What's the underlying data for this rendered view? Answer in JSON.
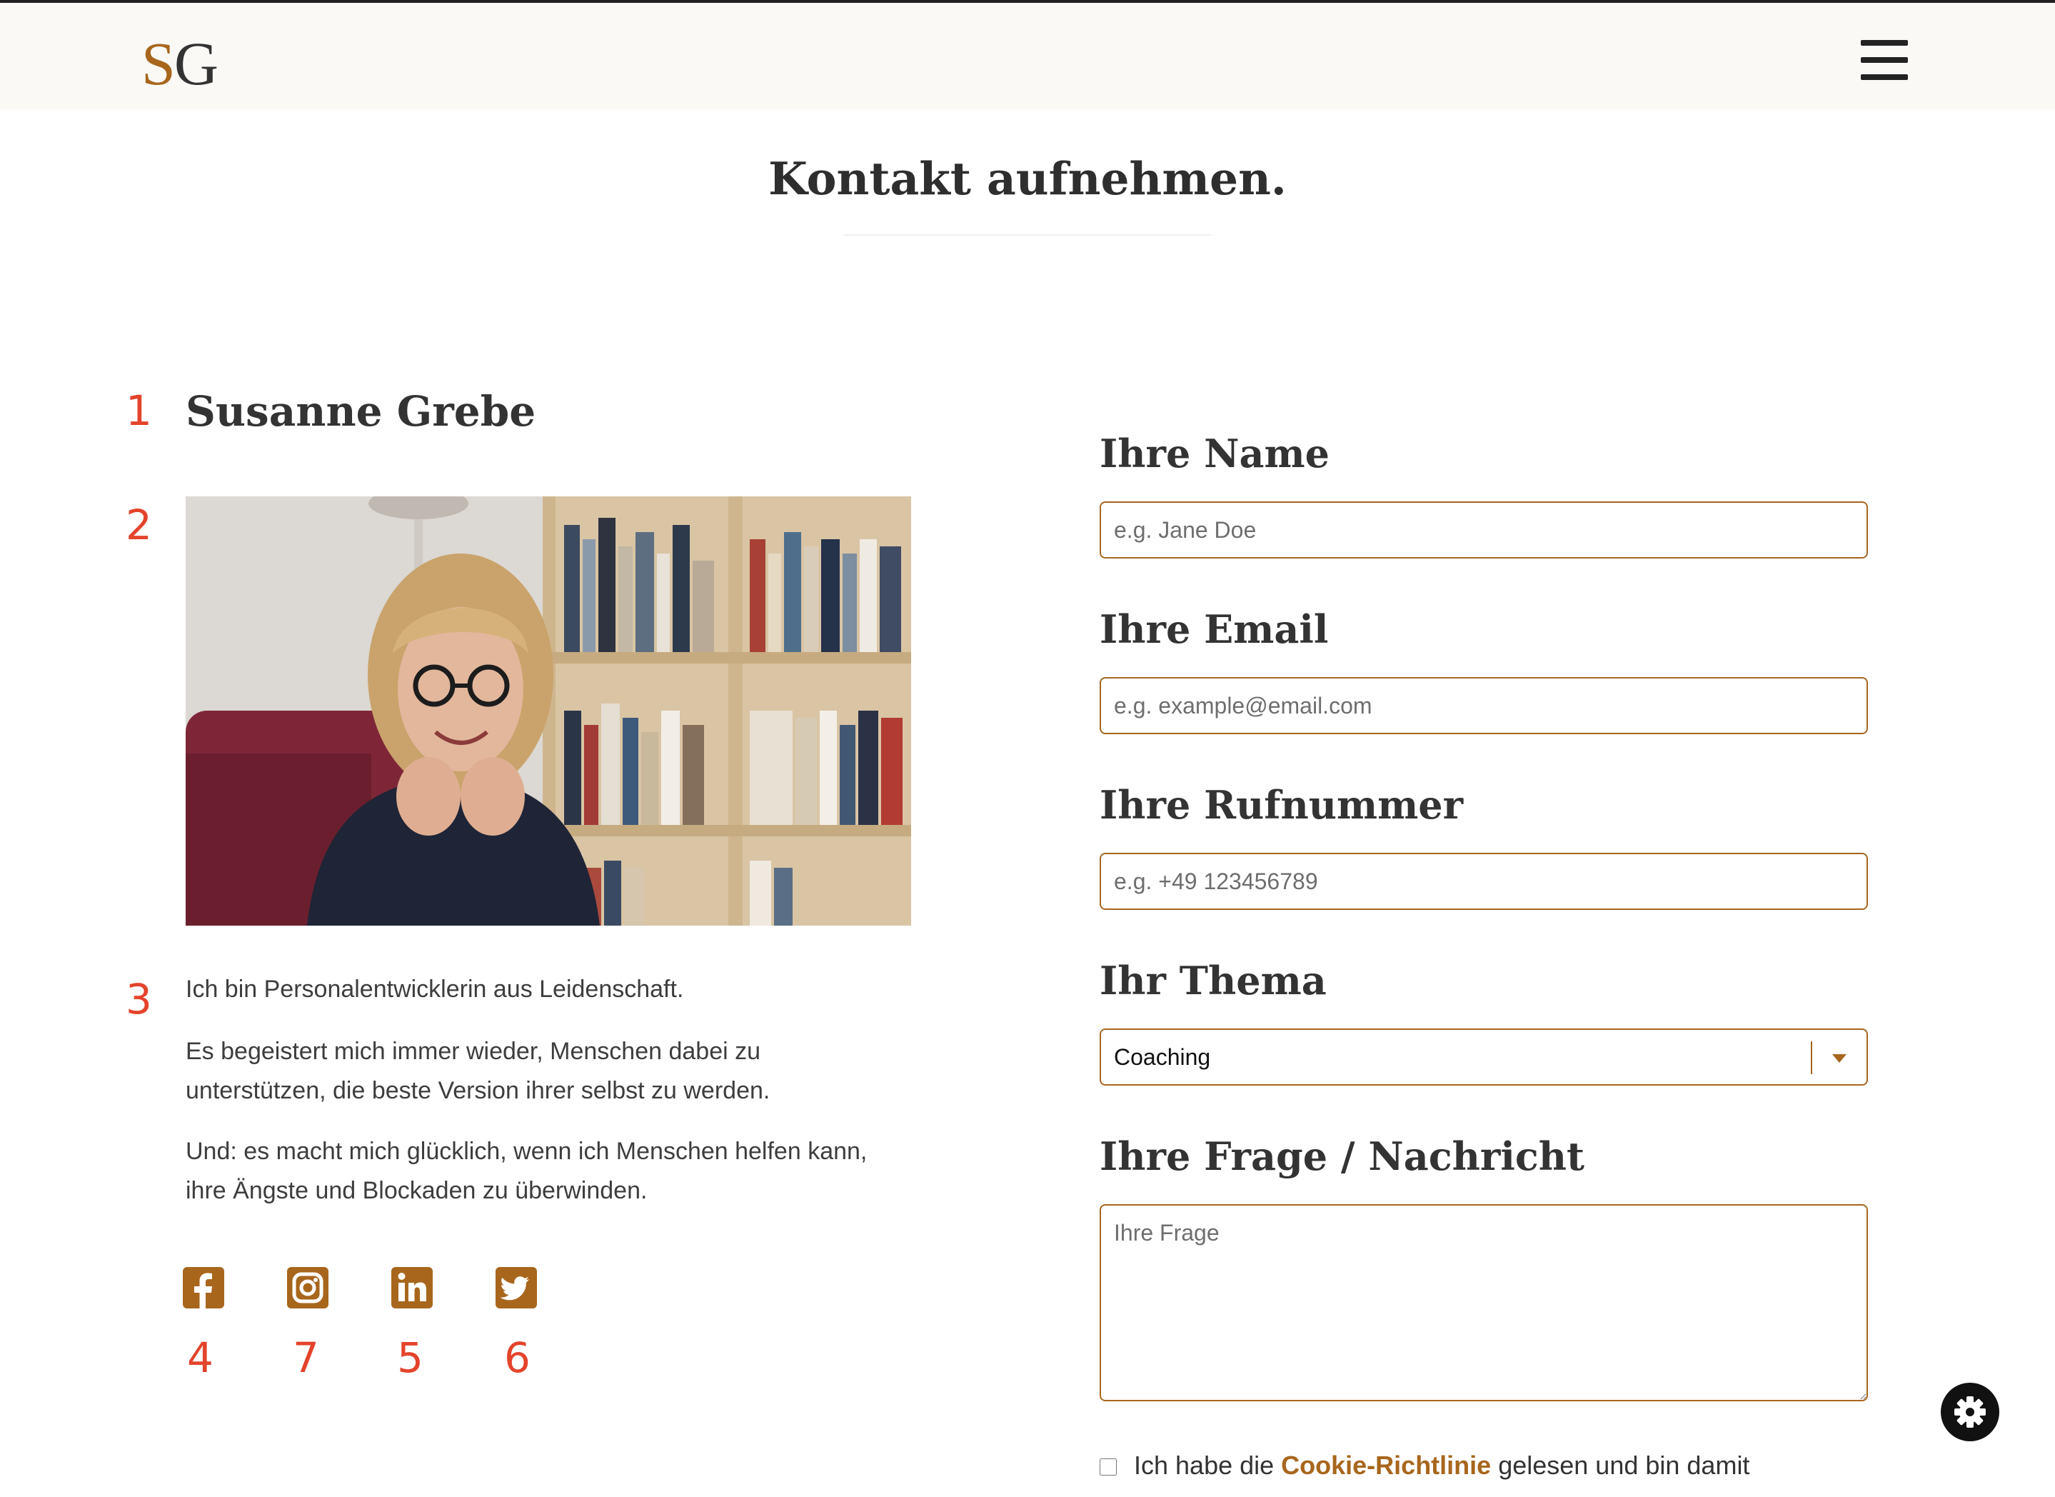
{
  "header": {
    "logo_first": "S",
    "logo_second": "G",
    "menu_icon": "hamburger-menu-icon"
  },
  "page_title": "Kontakt aufnehmen.",
  "profile": {
    "name": "Susanne Grebe",
    "photo": "portrait-photo",
    "bio": [
      "Ich bin Personalentwicklerin aus Leidenschaft.",
      "Es begeistert mich immer wieder, Menschen dabei zu unterstützen, die beste Version ihrer selbst zu werden.",
      "Und: es macht mich glücklich, wenn ich Menschen helfen kann, ihre Ängste und Blockaden zu überwinden."
    ],
    "social": [
      {
        "icon": "facebook-icon",
        "number": "4"
      },
      {
        "icon": "instagram-icon",
        "number": "7"
      },
      {
        "icon": "linkedin-icon",
        "number": "5"
      },
      {
        "icon": "twitter-icon",
        "number": "6"
      }
    ]
  },
  "annotations": [
    "1",
    "2",
    "3"
  ],
  "form": {
    "name_label": "Ihre Name",
    "name_placeholder": "e.g. Jane Doe",
    "email_label": "Ihre Email",
    "email_placeholder": "e.g. example@email.com",
    "phone_label": "Ihre Rufnummer",
    "phone_placeholder": "e.g. +49 123456789",
    "topic_label": "Ihr Thema",
    "topic_value": "Coaching",
    "message_label": "Ihre Frage / Nachricht",
    "message_placeholder": "Ihre Frage",
    "consent_before": "Ich habe die ",
    "consent_link": "Cookie-Richtlinie",
    "consent_after": " gelesen und bin damit"
  },
  "colors": {
    "accent": "#a8661d",
    "annotation": "#e4432b",
    "header_bg": "#faf9f6",
    "text": "#333333"
  },
  "cookie_settings_icon": "gear-icon"
}
